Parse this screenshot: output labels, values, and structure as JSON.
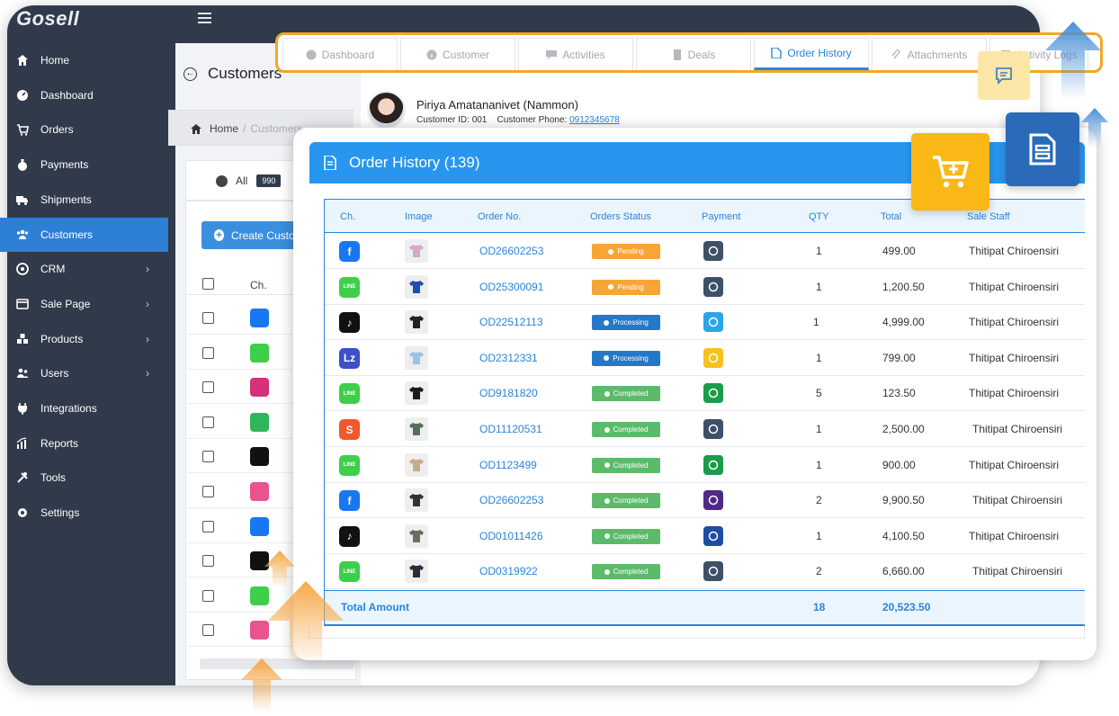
{
  "brand": {
    "logo_text": "Gosell"
  },
  "sidebar": {
    "items": [
      {
        "label": "Home",
        "icon": "home-icon"
      },
      {
        "label": "Dashboard",
        "icon": "dashboard-icon"
      },
      {
        "label": "Orders",
        "icon": "cart-icon"
      },
      {
        "label": "Payments",
        "icon": "money-bag-icon"
      },
      {
        "label": "Shipments",
        "icon": "truck-icon"
      },
      {
        "label": "Customers",
        "icon": "users-icon",
        "active": true
      },
      {
        "label": "CRM",
        "icon": "crm-icon",
        "chevron": true
      },
      {
        "label": "Sale Page",
        "icon": "browser-icon",
        "chevron": true
      },
      {
        "label": "Products",
        "icon": "boxes-icon",
        "chevron": true
      },
      {
        "label": "Users",
        "icon": "user-group-icon",
        "chevron": true
      },
      {
        "label": "Integrations",
        "icon": "plug-icon"
      },
      {
        "label": "Reports",
        "icon": "chart-icon"
      },
      {
        "label": "Tools",
        "icon": "tools-icon"
      },
      {
        "label": "Settings",
        "icon": "gear-icon"
      }
    ]
  },
  "customers_page": {
    "title": "Customers",
    "breadcrumb": {
      "home": "Home",
      "separator": "/",
      "current": "Customers"
    },
    "tab_all": {
      "label": "All",
      "count": "990"
    },
    "create_button": "Create Customer",
    "column_ch": "Ch."
  },
  "detail_tabs": [
    {
      "label": "Dashboard",
      "icon": "dashboard-icon"
    },
    {
      "label": "Customer",
      "icon": "info-icon"
    },
    {
      "label": "Activities",
      "icon": "comment-icon"
    },
    {
      "label": "Deals",
      "icon": "deal-icon"
    },
    {
      "label": "Order History",
      "icon": "document-icon",
      "active": true
    },
    {
      "label": "Attachments",
      "icon": "paperclip-icon"
    },
    {
      "label": "Activity Logs",
      "icon": "log-icon"
    }
  ],
  "customer": {
    "name": "Piriya Amatananivet (Nammon)",
    "id_label": "Customer ID:",
    "id": "001",
    "phone_label": "Customer Phone:",
    "phone": "0912345678"
  },
  "order_history": {
    "title": "Order History (139)",
    "columns": [
      "Ch.",
      "Image",
      "Order No.",
      "Orders Status",
      "Payment",
      "QTY",
      "Total",
      "Sale Staff"
    ],
    "rows": [
      {
        "channel": "facebook",
        "image": "tshirt-print",
        "order_no": "OD26602253",
        "status": "Pending",
        "payment": "cod-truck",
        "qty": "1",
        "total": "499.00",
        "staff": "Thitipat Chiroensiri"
      },
      {
        "channel": "line",
        "image": "tshirt-blue",
        "order_no": "OD25300091",
        "status": "Pending",
        "payment": "cod-truck",
        "qty": "1",
        "total": "1,200.50",
        "staff": "Thitipat Chiroensiri"
      },
      {
        "channel": "tiktok",
        "image": "shorts-black",
        "order_no": "OD22512113",
        "status": "Processing",
        "payment": "krungthai-bank",
        "qty": "1",
        "total": "4,999.00",
        "staff": "Thitipat Chiroensiri"
      },
      {
        "channel": "lazada",
        "image": "hoodie-blue",
        "order_no": "OD2312331",
        "status": "Processing",
        "payment": "krungsri-bank",
        "qty": "1",
        "total": "799.00",
        "staff": "Thitipat Chiroensiri"
      },
      {
        "channel": "line",
        "image": "jacket-black",
        "order_no": "OD9181820",
        "status": "Completed",
        "payment": "kbank",
        "qty": "5",
        "total": "123.50",
        "staff": "Thitipat Chiroensiri"
      },
      {
        "channel": "shopee",
        "image": "tanktop-green",
        "order_no": "OD11120531",
        "status": "Completed",
        "payment": "cod-truck",
        "qty": "1",
        "total": "2,500.00",
        "staff": "Thitipat Chiroensiri"
      },
      {
        "channel": "line",
        "image": "tshirt-beige",
        "order_no": "OD1123499",
        "status": "Completed",
        "payment": "kbank",
        "qty": "1",
        "total": "900.00",
        "staff": "Thitipat Chiroensiri"
      },
      {
        "channel": "facebook",
        "image": "tote-bag",
        "order_no": "OD26602253",
        "status": "Completed",
        "payment": "scb-bank",
        "qty": "2",
        "total": "9,900.50",
        "staff": "Thitipat Chiroensiri"
      },
      {
        "channel": "tiktok",
        "image": "skirt-grey",
        "order_no": "OD01011426",
        "status": "Completed",
        "payment": "krungthai-drop",
        "qty": "1",
        "total": "4,100.50",
        "staff": "Thitipat Chiroensiri"
      },
      {
        "channel": "line",
        "image": "shirt-check",
        "order_no": "OD0319922",
        "status": "Completed",
        "payment": "cod-truck",
        "qty": "2",
        "total": "6,660.00",
        "staff": "Thitipat Chiroensiri"
      }
    ],
    "total_label": "Total Amount",
    "total_qty": "18",
    "total_amount": "20,523.50"
  },
  "colors": {
    "sidebar_bg": "#303a4a",
    "accent_blue": "#2896ee",
    "link_blue": "#2b84d8",
    "pending": "#f7a535",
    "processing": "#2478c8",
    "completed": "#5cba6a",
    "highlight_orange": "#f4a629"
  }
}
